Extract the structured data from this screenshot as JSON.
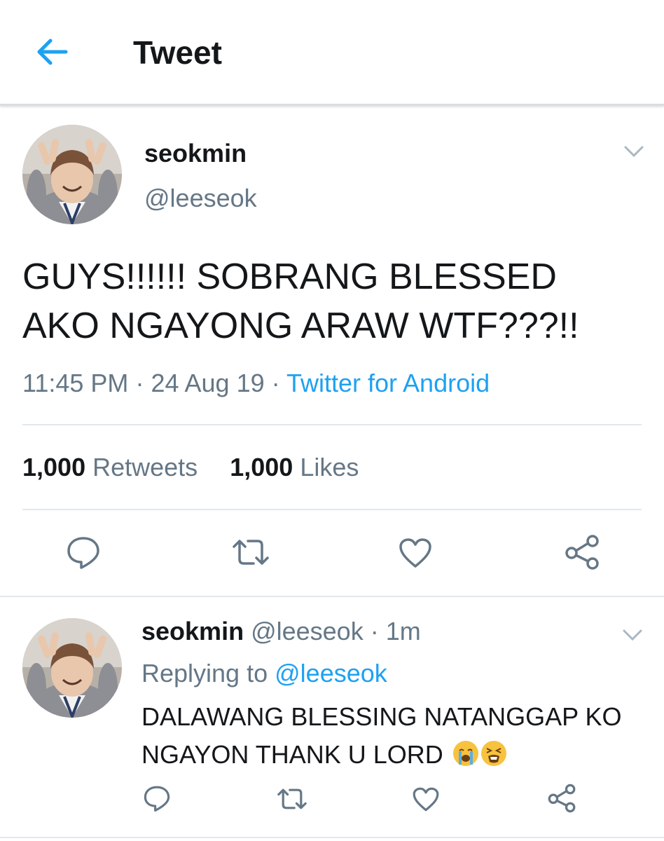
{
  "header": {
    "title": "Tweet",
    "back_icon": "arrow-left-icon",
    "accent": "#1da1f2"
  },
  "tweet": {
    "display_name": "seokmin",
    "handle": "@leeseok",
    "text": "GUYS!!!!!! SOBRANG BLESSED AKO NGAYONG ARAW WTF???!!",
    "time": "11:45 PM",
    "date": "24 Aug 19",
    "sep": "·",
    "source": "Twitter for Android",
    "retweets_count": "1,000",
    "retweets_label": "Retweets",
    "likes_count": "1,000",
    "likes_label": "Likes"
  },
  "actions": [
    "reply-icon",
    "retweet-icon",
    "like-icon",
    "share-icon"
  ],
  "reply": {
    "display_name": "seokmin",
    "handle": "@leeseok",
    "sep": "·",
    "time_ago": "1m",
    "replying_label": "Replying to",
    "replying_to": "@leeseok",
    "text": "DALAWANG BLESSING NATANGGAP KO NGAYON THANK U LORD",
    "emojis": [
      "loudly-crying-face-emoji",
      "tired-face-emoji"
    ]
  },
  "colors": {
    "text": "#14171a",
    "secondary": "#657786",
    "link": "#1da1f2",
    "divider": "#e1e8ed"
  }
}
